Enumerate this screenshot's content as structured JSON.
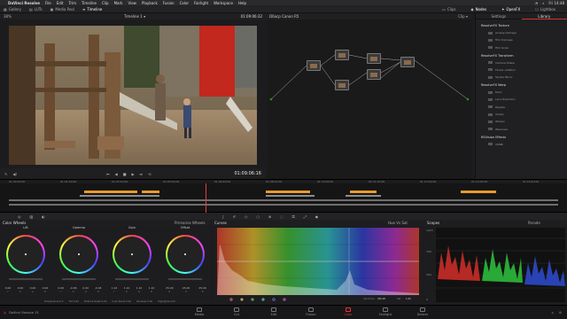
{
  "menubar": {
    "app": "DaVinci Resolve",
    "items": [
      "File",
      "Edit",
      "Trim",
      "Timeline",
      "Clip",
      "Mark",
      "View",
      "Playback",
      "Fusion",
      "Color",
      "Fairlight",
      "Workspace",
      "Help"
    ],
    "clock": "Fri 14:48"
  },
  "toolbar": {
    "items": [
      "Gallery",
      "LUTs",
      "Media Pool",
      "Timeline"
    ],
    "right": [
      "Clips",
      "Nodes",
      "OpenFX",
      "Lightbox"
    ]
  },
  "viewer": {
    "zoom": "38%",
    "timeline_name": "Timeline 1",
    "timecode_top": "01:09:06:32",
    "clip_name": "D6acp Canon R5",
    "mode": "Clip"
  },
  "library": {
    "tabs": [
      "Settings",
      "Library"
    ],
    "active_tab": "Library",
    "sections": [
      {
        "title": "ResolveFX Texture",
        "items": [
          "Analog Damage",
          "Film Damage",
          "Film Grain"
        ]
      },
      {
        "title": "ResolveFX Transform",
        "items": [
          "Camera Shake",
          "Flicker Addition",
          "Stylize Mirror"
        ]
      },
      {
        "title": "ResolveFX Warp",
        "items": [
          "Dent",
          "Lens Distortion",
          "Ripples",
          "Vortex",
          "Warper",
          "Waviness"
        ]
      },
      {
        "title": "RSVision Effects",
        "items": [
          "VSMB"
        ]
      }
    ]
  },
  "transport": {
    "timecode": "01:09:06:16"
  },
  "timeline": {
    "ruler": [
      "01:00:00:00",
      "01:01:40:00",
      "01:03:20:00",
      "01:05:00:00",
      "01:06:40:00",
      "01:08:20:00",
      "01:10:00:00",
      "01:11:40:00",
      "01:13:20:00",
      "01:15:00:00",
      "01:16:40:00"
    ]
  },
  "panels": {
    "wheels_title": "Color Wheels",
    "wheels_mode": "Primaries Wheels",
    "curves_title": "Curves",
    "curves_mode": "Hue Vs Sat",
    "scopes_title": "Scopes",
    "scopes_mode": "Parade"
  },
  "wheels": [
    {
      "name": "Lift",
      "values": [
        "0.00",
        "0.00",
        "0.00",
        "0.00"
      ],
      "labels": [
        "Y",
        "R",
        "G",
        "B"
      ]
    },
    {
      "name": "Gamma",
      "values": [
        "0.00",
        "-0.06",
        "0.00",
        "-0.04"
      ],
      "labels": [
        "Y",
        "R",
        "G",
        "B"
      ]
    },
    {
      "name": "Gain",
      "values": [
        "1.10",
        "1.10",
        "1.10",
        "1.10"
      ],
      "labels": [
        "Y",
        "R",
        "G",
        "B"
      ]
    },
    {
      "name": "Offset",
      "values": [
        "25.00",
        "25.00",
        "25.00"
      ],
      "labels": [
        "R",
        "G",
        "B"
      ]
    }
  ],
  "params": [
    "Temperature 0.0",
    "Tint 0.00",
    "Midtone Detail 0.00",
    "Color Boost 0.00",
    "Shadows 0.00",
    "Highlights 0.00"
  ],
  "curves": {
    "input_hue_label": "Input Hue",
    "input_hue": "256.00",
    "sat_label": "Sat",
    "sat": "1.00"
  },
  "status": {
    "app": "DaVinci Resolve 15"
  },
  "pages": [
    "Media",
    "Cut",
    "Edit",
    "Fusion",
    "Color",
    "Fairlight",
    "Deliver"
  ],
  "active_page": "Color",
  "colors": {
    "accent": "#e33e3e",
    "node_green": "#3b8a2b"
  }
}
